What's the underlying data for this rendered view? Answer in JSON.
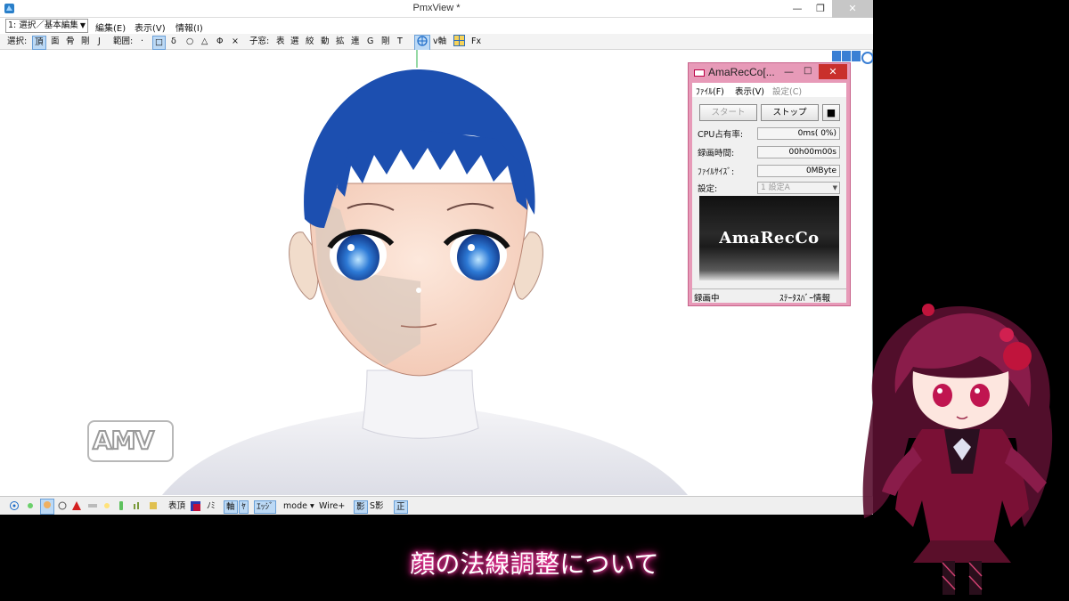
{
  "pmxview": {
    "title": "PmxView *",
    "window_buttons": {
      "minimize": "—",
      "restore": "❐",
      "close": "✕"
    },
    "menu": {
      "mode_select": "1: 選択／基本編集",
      "items": [
        "編集(E)",
        "表示(V)",
        "情報(I)"
      ]
    },
    "toolbar": {
      "select_label": "選択:",
      "select_items": [
        "頂",
        "面",
        "骨",
        "剛",
        "J"
      ],
      "range_label": "範囲:",
      "range_items": [
        "·",
        "□",
        "δ",
        "○",
        "△",
        "Φ",
        "×"
      ],
      "child_label": "子窓:",
      "child_items": [
        "表",
        "選",
        "絞",
        "動",
        "拡",
        "連",
        "G",
        "剛",
        "T"
      ],
      "v_axis": "v軸",
      "fx": "Fx"
    },
    "statusbar": {
      "items": [
        "表頂",
        "ﾉﾐ",
        "軸",
        "ﾔ",
        "ｴｯｼﾞ",
        "mode ▾",
        "Wire+",
        "影",
        "S影",
        "正"
      ]
    }
  },
  "amarecco": {
    "title": "AmaRecCo[...",
    "window_buttons": {
      "minimize": "—",
      "maximize": "□",
      "close": "✕"
    },
    "menu": [
      "ﾌｧｲﾙ(F)",
      "表示(V)",
      "設定(C)"
    ],
    "buttons": {
      "start": "スタート",
      "stop": "ストップ",
      "square": "■"
    },
    "cpu_label": "CPU占有率:",
    "cpu_value": "0ms( 0%)",
    "rec_time_label": "録画時間:",
    "rec_time_value": "00h00m00s",
    "file_size_label": "ﾌｧｲﾙｻｲｽﾞ:",
    "file_size_value": "0MByte",
    "setting_label": "設定:",
    "setting_value": "1 設定A",
    "logo": "AmaRecCo",
    "status_left": "録画中",
    "status_right": "ｽﾃｰﾀｽﾊﾞｰ情報"
  },
  "watermark": "AMV",
  "subtitle": "顔の法線調整について",
  "colors": {
    "hair": "#1c4fb0",
    "skin": "#f7d9c9",
    "amarecco_frame": "#e79ab8",
    "subtitle_glow": "#ff3fa8"
  }
}
